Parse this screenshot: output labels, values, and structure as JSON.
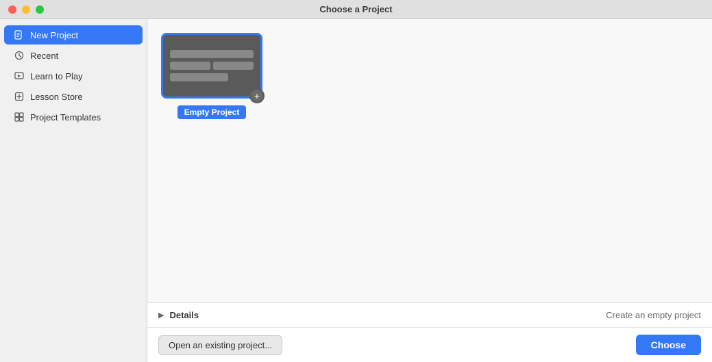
{
  "titlebar": {
    "title": "Choose a Project"
  },
  "sidebar": {
    "items": [
      {
        "id": "new-project",
        "label": "New Project",
        "icon": "new-project-icon",
        "active": true
      },
      {
        "id": "recent",
        "label": "Recent",
        "icon": "recent-icon",
        "active": false
      },
      {
        "id": "learn-to-play",
        "label": "Learn to Play",
        "icon": "learn-to-play-icon",
        "active": false
      },
      {
        "id": "lesson-store",
        "label": "Lesson Store",
        "icon": "lesson-store-icon",
        "active": false
      },
      {
        "id": "project-templates",
        "label": "Project Templates",
        "icon": "project-templates-icon",
        "active": false
      }
    ]
  },
  "content": {
    "project_card_label": "Empty Project"
  },
  "bottom": {
    "details_label": "Details",
    "details_desc": "Create an empty project",
    "open_existing_label": "Open an existing project...",
    "choose_label": "Choose"
  }
}
